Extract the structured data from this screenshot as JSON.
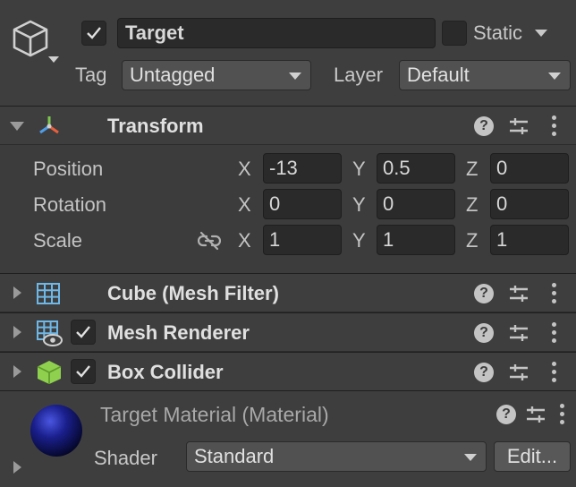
{
  "header": {
    "object_name": "Target",
    "active_checked": true,
    "static_label": "Static",
    "static_checked": false,
    "tag_label": "Tag",
    "tag_value": "Untagged",
    "layer_label": "Layer",
    "layer_value": "Default"
  },
  "transform": {
    "title": "Transform",
    "rows": [
      {
        "label": "Position",
        "x": "-13",
        "y": "0.5",
        "z": "0"
      },
      {
        "label": "Rotation",
        "x": "0",
        "y": "0",
        "z": "0"
      },
      {
        "label": "Scale",
        "x": "1",
        "y": "1",
        "z": "1"
      }
    ],
    "axis_x": "X",
    "axis_y": "Y",
    "axis_z": "Z"
  },
  "components": [
    {
      "title": "Cube (Mesh Filter)",
      "icon": "mesh-filter-icon",
      "has_checkbox": false
    },
    {
      "title": "Mesh Renderer",
      "icon": "mesh-renderer-icon",
      "has_checkbox": true,
      "checked": true
    },
    {
      "title": "Box Collider",
      "icon": "box-collider-icon",
      "has_checkbox": true,
      "checked": true
    }
  ],
  "material": {
    "title": "Target Material (Material)",
    "shader_label": "Shader",
    "shader_value": "Standard",
    "edit_label": "Edit..."
  },
  "colors": {
    "background": "#3c3c3c",
    "field": "#2a2a2a",
    "text": "#d2d2d2",
    "collider_green": "#8fd14f",
    "grid_blue": "#6fb7e6",
    "material_blue": "#1a1f8c"
  }
}
